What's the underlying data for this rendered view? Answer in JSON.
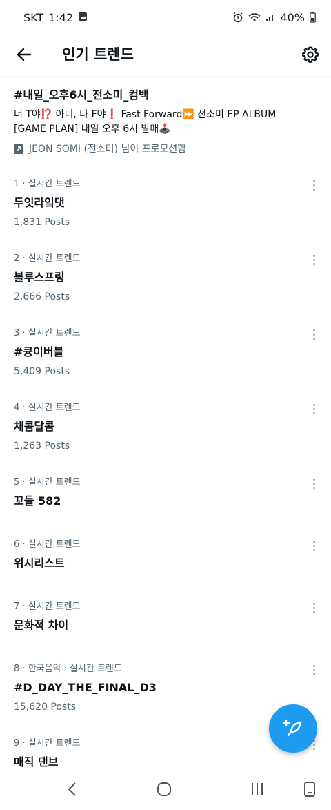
{
  "status_bar": {
    "carrier": "SKT",
    "time": "1:42",
    "battery": "40%"
  },
  "header": {
    "title": "인기 트렌드"
  },
  "promoted": {
    "hashtag": "#내일_오후6시_전소미_컴백",
    "description": "너 T야⁉️ 아니, 나 F야❗ Fast Forward⏩  전소미 EP ALBUM [GAME PLAN] 내일 오후 6시 발매🕹️",
    "promoted_by": "JEON SOMI (전소미) 님이 프로모션함"
  },
  "trends": [
    {
      "rank": "1",
      "category": "실시간 트렌드",
      "name": "두잇라잌댓",
      "posts": "1,831 Posts"
    },
    {
      "rank": "2",
      "category": "실시간 트렌드",
      "name": "블루스프링",
      "posts": "2,666 Posts"
    },
    {
      "rank": "3",
      "category": "실시간 트렌드",
      "name": "#큥이버블",
      "posts": "5,409 Posts"
    },
    {
      "rank": "4",
      "category": "실시간 트렌드",
      "name": "채콤달콤",
      "posts": "1,263 Posts"
    },
    {
      "rank": "5",
      "category": "실시간 트렌드",
      "name": "꼬들 582",
      "posts": ""
    },
    {
      "rank": "6",
      "category": "실시간 트렌드",
      "name": "위시리스트",
      "posts": ""
    },
    {
      "rank": "7",
      "category": "실시간 트렌드",
      "name": "문화적 차이",
      "posts": ""
    },
    {
      "rank": "8",
      "category": "한국음악 · 실시간 트렌드",
      "name": "#D_DAY_THE_FINAL_D3",
      "posts": "15,620 Posts"
    },
    {
      "rank": "9",
      "category": "실시간 트렌드",
      "name": "매직 댄브",
      "posts": ""
    }
  ],
  "colors": {
    "accent": "#1d9bf0",
    "secondary_text": "#536471",
    "primary_text": "#0f1419"
  }
}
